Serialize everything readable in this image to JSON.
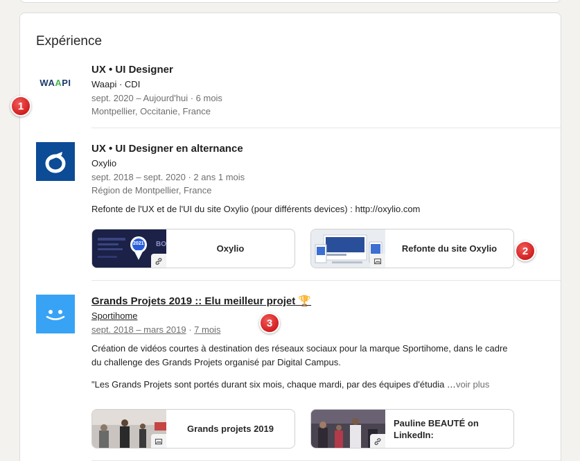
{
  "section": {
    "title": "Expérience"
  },
  "entries": [
    {
      "logo_text": [
        "WA",
        "A",
        "PI"
      ],
      "title": "UX • UI Designer",
      "company": "Waapi · CDI",
      "dates": "sept. 2020 – Aujourd'hui · 6 mois",
      "location": "Montpellier, Occitanie, France"
    },
    {
      "title": "UX • UI Designer en alternance",
      "company": "Oxylio",
      "dates": "sept. 2018 – sept. 2020 · 2 ans 1 mois",
      "location": "Région de Montpellier, France",
      "description": "Refonte de l'UX et de l'UI du site Oxylio (pour différents devices) : http://oxylio.com",
      "media": [
        {
          "label": "Oxylio",
          "thumb_text": "2021",
          "thumb_text2": "BO",
          "badge_icon": "link-icon"
        },
        {
          "label": "Refonte du site Oxylio",
          "badge_icon": "image-icon"
        }
      ]
    },
    {
      "title": "Grands Projets 2019 :: Elu meilleur projet 🏆",
      "company": "Sportihome",
      "dates_range": "sept. 2018 – mars 2019",
      "dates_sep": " · ",
      "duration": "7 mois",
      "description": "Création de vidéos courtes à destination des réseaux sociaux pour la marque Sportihome, dans le cadre du challenge des Grands Projets organisé par Digital Campus.",
      "quote": "\"Les Grands Projets sont portés durant six mois, chaque mardi, par des équipes d'étudia …",
      "see_more": "voir plus",
      "media": [
        {
          "label": "Grands projets 2019",
          "badge_icon": "image-icon"
        },
        {
          "label": "Pauline BEAUTÉ on LinkedIn:",
          "badge_icon": "link-icon"
        }
      ]
    }
  ],
  "markers": [
    "1",
    "2",
    "3"
  ],
  "colors": {
    "oxylio_blue": "#0c4b96",
    "sportihome_blue": "#38a3f5",
    "marker_red": "#d21f1f"
  }
}
